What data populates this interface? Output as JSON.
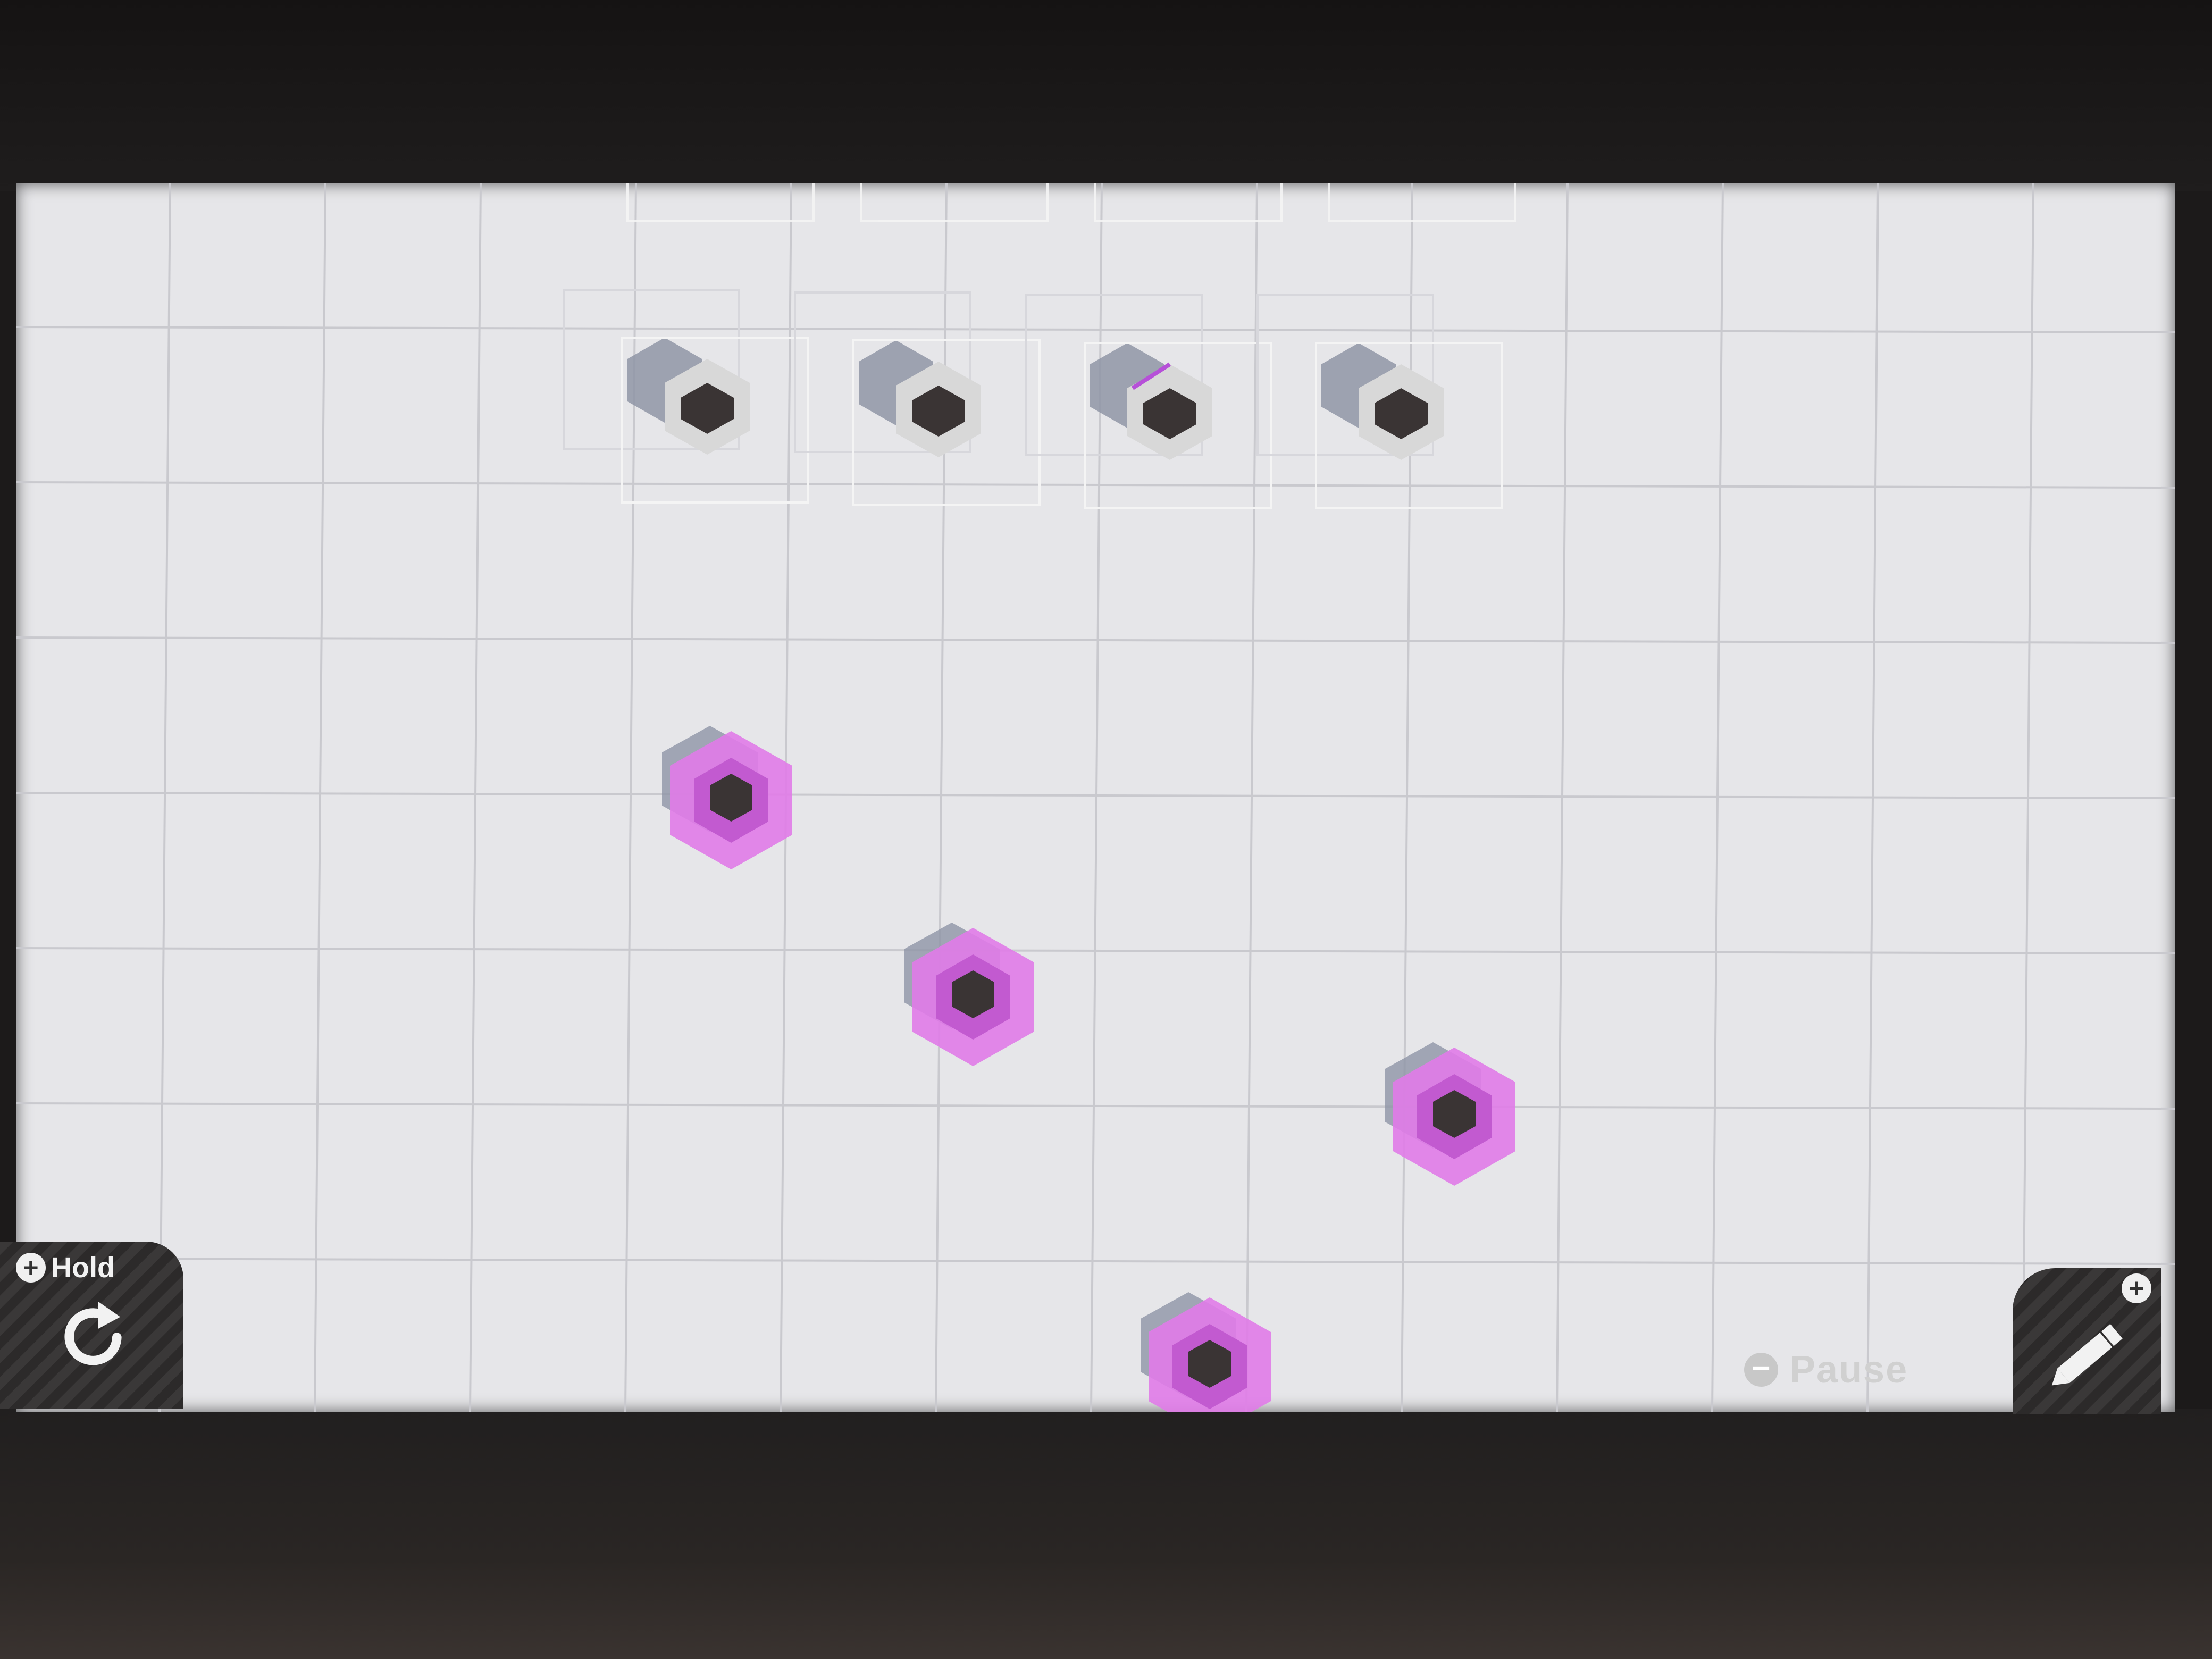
{
  "hud": {
    "hold_label": "Hold",
    "hold_icon": "rotate-icon",
    "pause_label": "Pause",
    "edit_icon": "pencil-icon"
  },
  "colors": {
    "field_background": "#e6e6e9",
    "grid_line": "#c9c9ce",
    "piece_core": "#3a3434",
    "piece_ring_inactive": "#d8d8d8",
    "piece_ring_active": "#e07be8",
    "piece_shadow": "#8f95a6"
  }
}
